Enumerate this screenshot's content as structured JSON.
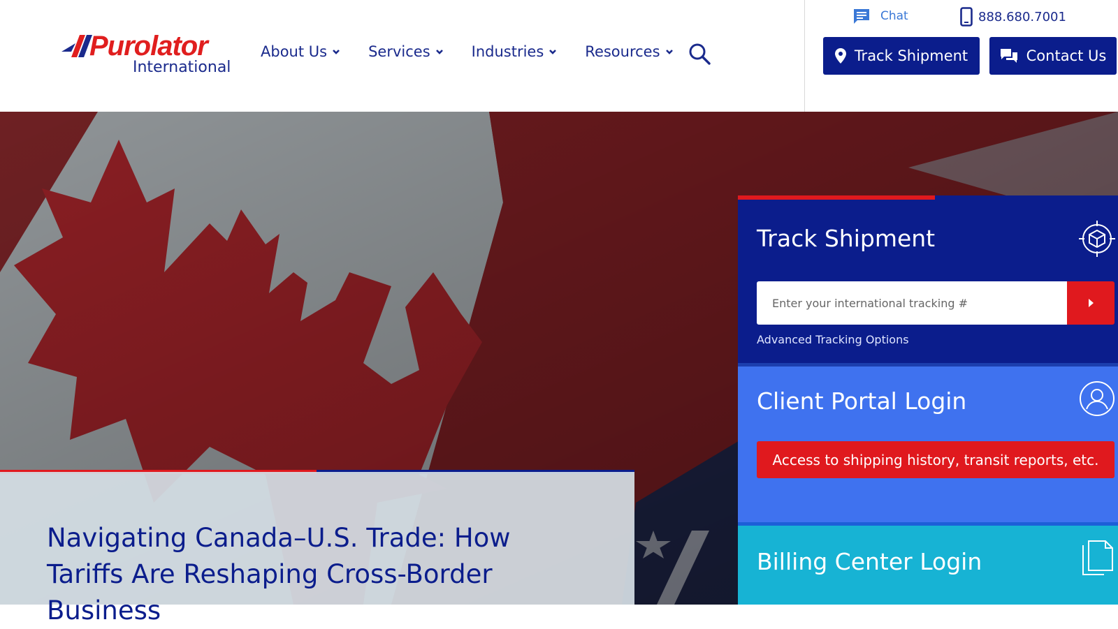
{
  "brand": {
    "name": "Purolator",
    "sub": "International",
    "red": "#e01e1e",
    "navy": "#0b1d8c"
  },
  "nav": {
    "items": [
      {
        "label": "About Us",
        "icon": "chevron-down-icon"
      },
      {
        "label": "Services",
        "icon": "chevron-down-icon"
      },
      {
        "label": "Industries",
        "icon": "chevron-down-icon"
      },
      {
        "label": "Resources",
        "icon": "chevron-down-icon"
      }
    ],
    "search_icon": "search-icon"
  },
  "utility": {
    "chat_label": "Chat",
    "phone": "888.680.7001"
  },
  "header_buttons": {
    "track_label": "Track Shipment",
    "contact_label": "Contact Us"
  },
  "hero": {
    "article_title": "Navigating Canada–U.S. Trade: How Tariffs Are Reshaping Cross-Border Business"
  },
  "panels": {
    "track": {
      "title": "Track Shipment",
      "placeholder": "Enter your international tracking #",
      "advanced_link": "Advanced Tracking Options",
      "bg": "#0b1d8c"
    },
    "client": {
      "title": "Client Portal Login",
      "button": "Access to shipping history, transit reports, etc.",
      "bg": "#3f72ef"
    },
    "billing": {
      "title": "Billing Center Login",
      "bg": "#17b3d4"
    }
  }
}
